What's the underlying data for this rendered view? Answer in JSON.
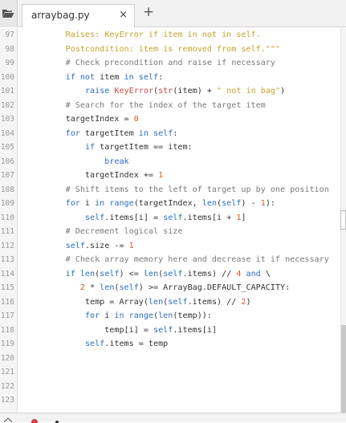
{
  "tab": {
    "title": "arraybag.py",
    "close_glyph": "×",
    "new_tab_glyph": "+"
  },
  "icons": {
    "open_files": "folder-open-icon",
    "close": "close-icon",
    "new_tab": "plus-icon"
  },
  "colors": {
    "keyword": "#2c6cc4",
    "string": "#c6a32c",
    "number": "#e05a2a",
    "builtin": "#d04444",
    "comment": "#7a7a7a",
    "text": "#333333"
  },
  "editor": {
    "lines": [
      {
        "num": "97",
        "segs": [
          [
            "        ",
            ""
          ],
          [
            "Raises: KeyError if item in not in self.",
            "s"
          ]
        ]
      },
      {
        "num": "98",
        "segs": [
          [
            "        ",
            ""
          ],
          [
            "Postcondition: item is removed from self.\"\"\"",
            "s"
          ]
        ]
      },
      {
        "num": "99",
        "segs": [
          [
            "        ",
            ""
          ],
          [
            "# Check precondition and raise if necessary",
            "c"
          ]
        ]
      },
      {
        "num": "100",
        "segs": [
          [
            "        ",
            ""
          ],
          [
            "if",
            "k"
          ],
          [
            " ",
            ""
          ],
          [
            "not",
            "k"
          ],
          [
            " item ",
            ""
          ],
          [
            "in",
            "k"
          ],
          [
            " ",
            ""
          ],
          [
            "self",
            "k"
          ],
          [
            ":",
            ""
          ]
        ]
      },
      {
        "num": "101",
        "segs": [
          [
            "            ",
            ""
          ],
          [
            "raise",
            "k"
          ],
          [
            " ",
            ""
          ],
          [
            "KeyError",
            "b"
          ],
          [
            "(",
            ""
          ],
          [
            "str",
            "b"
          ],
          [
            "(item) + ",
            ""
          ],
          [
            "\" not in bag\"",
            "s"
          ],
          [
            ")",
            ""
          ]
        ]
      },
      {
        "num": "102",
        "segs": [
          [
            "        ",
            ""
          ],
          [
            "# Search for the index of the target item",
            "c"
          ]
        ]
      },
      {
        "num": "103",
        "segs": [
          [
            "        targetIndex = ",
            ""
          ],
          [
            "0",
            "n"
          ]
        ]
      },
      {
        "num": "104",
        "segs": [
          [
            "        ",
            ""
          ],
          [
            "for",
            "k"
          ],
          [
            " targetItem ",
            ""
          ],
          [
            "in",
            "k"
          ],
          [
            " ",
            ""
          ],
          [
            "self",
            "k"
          ],
          [
            ":",
            ""
          ]
        ]
      },
      {
        "num": "105",
        "segs": [
          [
            "            ",
            ""
          ],
          [
            "if",
            "k"
          ],
          [
            " targetItem == item:",
            ""
          ]
        ]
      },
      {
        "num": "106",
        "segs": [
          [
            "                ",
            ""
          ],
          [
            "break",
            "k"
          ]
        ]
      },
      {
        "num": "107",
        "segs": [
          [
            "            targetIndex += ",
            ""
          ],
          [
            "1",
            "n"
          ]
        ]
      },
      {
        "num": "108",
        "segs": [
          [
            "        ",
            ""
          ],
          [
            "# Shift items to the left of target up by one position",
            "c"
          ]
        ]
      },
      {
        "num": "109",
        "segs": [
          [
            "        ",
            ""
          ],
          [
            "for",
            "k"
          ],
          [
            " i ",
            ""
          ],
          [
            "in",
            "k"
          ],
          [
            " ",
            ""
          ],
          [
            "range",
            "k"
          ],
          [
            "(targetIndex, ",
            ""
          ],
          [
            "len",
            "k"
          ],
          [
            "(",
            ""
          ],
          [
            "self",
            "k"
          ],
          [
            ") - ",
            ""
          ],
          [
            "1",
            "n"
          ],
          [
            "):",
            ""
          ]
        ]
      },
      {
        "num": "110",
        "segs": [
          [
            "            ",
            ""
          ],
          [
            "self",
            "k"
          ],
          [
            ".items[i] = ",
            ""
          ],
          [
            "self",
            "k"
          ],
          [
            ".items[i + ",
            ""
          ],
          [
            "1",
            "n"
          ],
          [
            "]",
            ""
          ]
        ]
      },
      {
        "num": "111",
        "segs": [
          [
            "        ",
            ""
          ],
          [
            "# Decrement logical size",
            "c"
          ]
        ]
      },
      {
        "num": "112",
        "segs": [
          [
            "        ",
            ""
          ],
          [
            "self",
            "k"
          ],
          [
            ".size -= ",
            ""
          ],
          [
            "1",
            "n"
          ]
        ]
      },
      {
        "num": "113",
        "segs": [
          [
            "        ",
            ""
          ],
          [
            "# Check array memory here and decrease it if necessary",
            "c"
          ]
        ]
      },
      {
        "num": "114",
        "segs": [
          [
            "        ",
            ""
          ],
          [
            "if",
            "k"
          ],
          [
            " ",
            ""
          ],
          [
            "len",
            "k"
          ],
          [
            "(",
            ""
          ],
          [
            "self",
            "k"
          ],
          [
            ") <= ",
            ""
          ],
          [
            "len",
            "k"
          ],
          [
            "(",
            ""
          ],
          [
            "self",
            "k"
          ],
          [
            ".items) // ",
            ""
          ],
          [
            "4",
            "n"
          ],
          [
            " ",
            ""
          ],
          [
            "and",
            "k"
          ],
          [
            " \\",
            ""
          ]
        ]
      },
      {
        "num": "115",
        "segs": [
          [
            "           ",
            ""
          ],
          [
            "2",
            "n"
          ],
          [
            " * ",
            ""
          ],
          [
            "len",
            "k"
          ],
          [
            "(",
            ""
          ],
          [
            "self",
            "k"
          ],
          [
            ") >= ArrayBag.DEFAULT_CAPACITY:",
            ""
          ]
        ]
      },
      {
        "num": "116",
        "segs": [
          [
            "            temp = Array(",
            ""
          ],
          [
            "len",
            "k"
          ],
          [
            "(",
            ""
          ],
          [
            "self",
            "k"
          ],
          [
            ".items) // ",
            ""
          ],
          [
            "2",
            "n"
          ],
          [
            ")",
            ""
          ]
        ]
      },
      {
        "num": "117",
        "segs": [
          [
            "            ",
            ""
          ],
          [
            "for",
            "k"
          ],
          [
            " i ",
            ""
          ],
          [
            "in",
            "k"
          ],
          [
            " ",
            ""
          ],
          [
            "range",
            "k"
          ],
          [
            "(",
            ""
          ],
          [
            "len",
            "k"
          ],
          [
            "(temp)):",
            ""
          ]
        ]
      },
      {
        "num": "118",
        "segs": [
          [
            "                temp[i] = ",
            ""
          ],
          [
            "self",
            "k"
          ],
          [
            ".items[i]",
            ""
          ]
        ]
      },
      {
        "num": "119",
        "segs": [
          [
            "            ",
            ""
          ],
          [
            "self",
            "k"
          ],
          [
            ".items = temp",
            ""
          ]
        ]
      },
      {
        "num": "120",
        "segs": []
      },
      {
        "num": "121",
        "segs": []
      },
      {
        "num": "122",
        "segs": []
      },
      {
        "num": "123",
        "segs": []
      }
    ]
  }
}
